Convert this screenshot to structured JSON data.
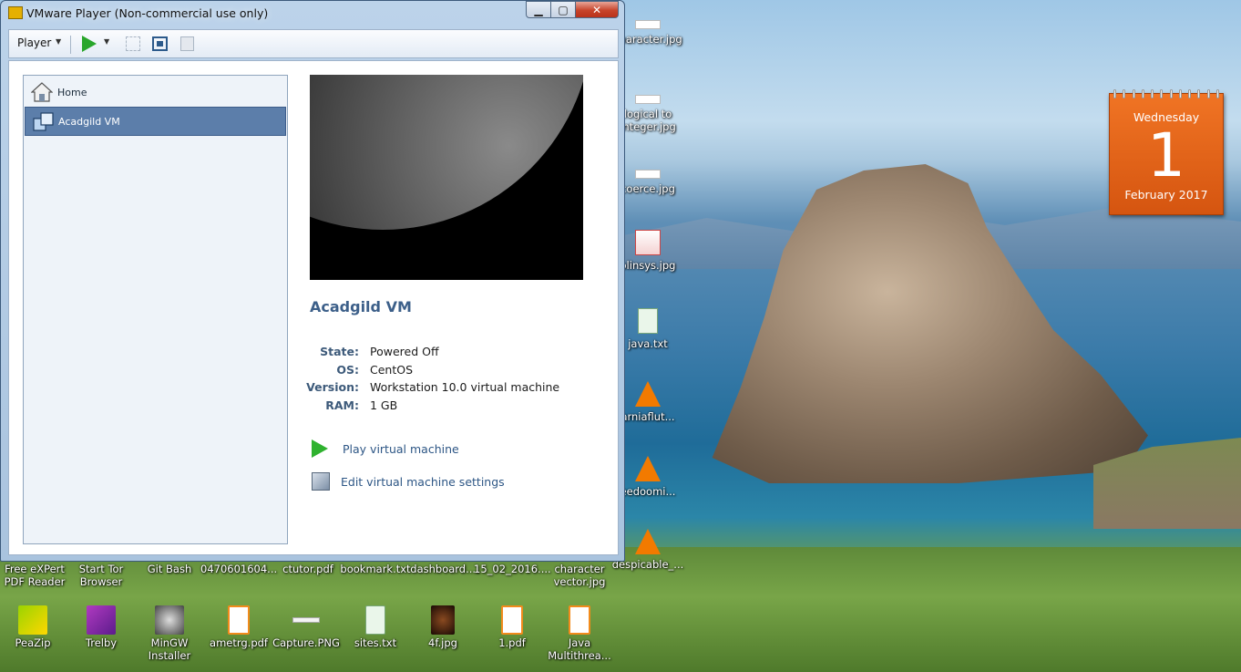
{
  "window": {
    "title": "VMware Player (Non-commercial use only)",
    "min": "▁",
    "max": "▢",
    "close": "✕"
  },
  "toolbar": {
    "player_menu": "Player",
    "dropdown_arrow": "▼"
  },
  "library": {
    "home": "Home",
    "vm": "Acadgild VM"
  },
  "vm": {
    "name": "Acadgild VM",
    "state_label": "State:",
    "state_value": "Powered Off",
    "os_label": "OS:",
    "os_value": "CentOS",
    "version_label": "Version:",
    "version_value": "Workstation 10.0 virtual machine",
    "ram_label": "RAM:",
    "ram_value": "1 GB"
  },
  "actions": {
    "play": "Play virtual machine",
    "edit": "Edit virtual machine settings"
  },
  "calendar": {
    "day": "Wednesday",
    "date": "1",
    "month": "February 2017"
  },
  "desktop_right": [
    {
      "label": "character.jpg",
      "icon": "image-file-icon"
    },
    {
      "label": "logical to integer.jpg",
      "icon": "image-file-icon"
    },
    {
      "label": "coerce.jpg",
      "icon": "image-file-icon"
    },
    {
      "label": "olinsys.jpg",
      "icon": "image-file-icon"
    },
    {
      "label": "java.txt",
      "icon": "text-file-icon"
    },
    {
      "label": "arniaflut...",
      "icon": "vlc-icon"
    },
    {
      "label": "eedoomi...",
      "icon": "vlc-icon"
    },
    {
      "label": "despicable_...",
      "icon": "vlc-icon"
    }
  ],
  "desktop_row1": [
    "Free eXPert PDF Reader",
    "Start Tor Browser",
    "Git Bash",
    "0470601604...",
    "ctutor.pdf",
    "bookmark.txt",
    "dashboard....",
    "15_02_2016....",
    "character vector.jpg"
  ],
  "desktop_row2": [
    {
      "label": "PeaZip",
      "icon": "peazip-icon"
    },
    {
      "label": "Trelby",
      "icon": "trelby-icon"
    },
    {
      "label": "MinGW Installer",
      "icon": "mingw-icon"
    },
    {
      "label": "ametrg.pdf",
      "icon": "pdf-icon"
    },
    {
      "label": "Capture.PNG",
      "icon": "image-file-icon"
    },
    {
      "label": "sites.txt",
      "icon": "text-file-icon"
    },
    {
      "label": "4f.jpg",
      "icon": "image-file-icon"
    },
    {
      "label": "1.pdf",
      "icon": "pdf-icon"
    },
    {
      "label": "Java Multithrea...",
      "icon": "pdf-icon"
    }
  ],
  "colors": {
    "accent": "#5c7eaa",
    "play_green": "#2fb22f",
    "calendar_orange": "#e8661a"
  }
}
